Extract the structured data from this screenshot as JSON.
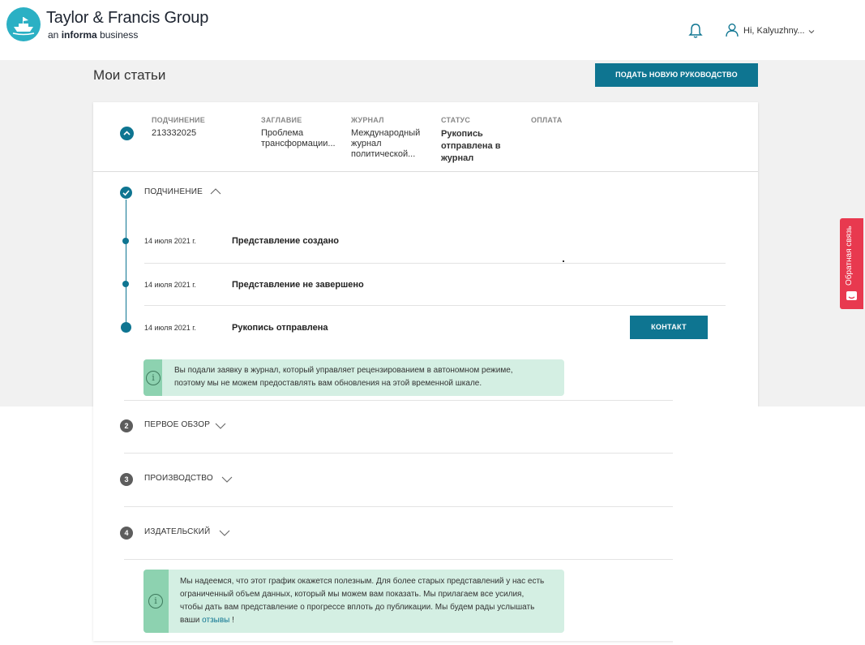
{
  "header": {
    "brand_title": "Taylor & Francis Group",
    "brand_sub_prefix": "an",
    "brand_sub_bold": "informa",
    "brand_sub_suffix": "business",
    "greeting": "Hi, Kalyuzhny..."
  },
  "page": {
    "title": "Мои статьи",
    "submit_button": "ПОДАТЬ НОВУЮ РУКОВОДСТВО"
  },
  "submission": {
    "columns": [
      {
        "header": "ПОДЧИНЕНИЕ",
        "value": "213332025"
      },
      {
        "header": "ЗАГЛАВИЕ",
        "value": "Проблема трансформации..."
      },
      {
        "header": "ЖУРНАЛ",
        "value": "Международный журнал политической..."
      },
      {
        "header": "СТАТУС",
        "value": "Рукопись отправлена в журнал"
      },
      {
        "header": "ОПЛАТА",
        "value": ""
      }
    ]
  },
  "timeline": {
    "step1": {
      "label": "ПОДЧИНЕНИЕ",
      "events": [
        {
          "date": "14 июля 2021 г.",
          "title": "Представление создано"
        },
        {
          "date": "14 июля 2021 г.",
          "title": "Представление не завершено"
        },
        {
          "date": "14 июля 2021 г.",
          "title": "Рукопись отправлена"
        }
      ],
      "contact_button": "КОНТАКТ",
      "info_line1": "Вы подали заявку в журнал, который управляет рецензированием в автономном режиме,",
      "info_line2": "поэтому мы не можем предоставлять вам обновления на этой временной шкале."
    },
    "steps": [
      {
        "number": "2",
        "label": "ПЕРВОЕ ОБЗОР"
      },
      {
        "number": "3",
        "label": "ПРОИЗВОДСТВО"
      },
      {
        "number": "4",
        "label": "ИЗДАТЕЛЬСКИЙ"
      }
    ],
    "bottom_info": {
      "line1": "Мы надеемся, что этот график окажется полезным. Для более старых представлений у нас есть",
      "line2": "ограниченный объем данных, который мы можем вам показать. Мы прилагаем все усилия,",
      "line3": "чтобы дать вам представление о прогрессе вплоть до публикации. Мы будем рады услышать",
      "line4_prefix": "ваши",
      "line4_link": "отзывы",
      "line4_suffix": "!"
    }
  },
  "feedback_tab": {
    "label": "Обратная связь"
  },
  "colors": {
    "primary": "#0e7591",
    "info_bg": "#d4efe3",
    "info_bar": "#8dd2b0",
    "feedback": "#e8394f",
    "logo": "#2bb0c4"
  }
}
